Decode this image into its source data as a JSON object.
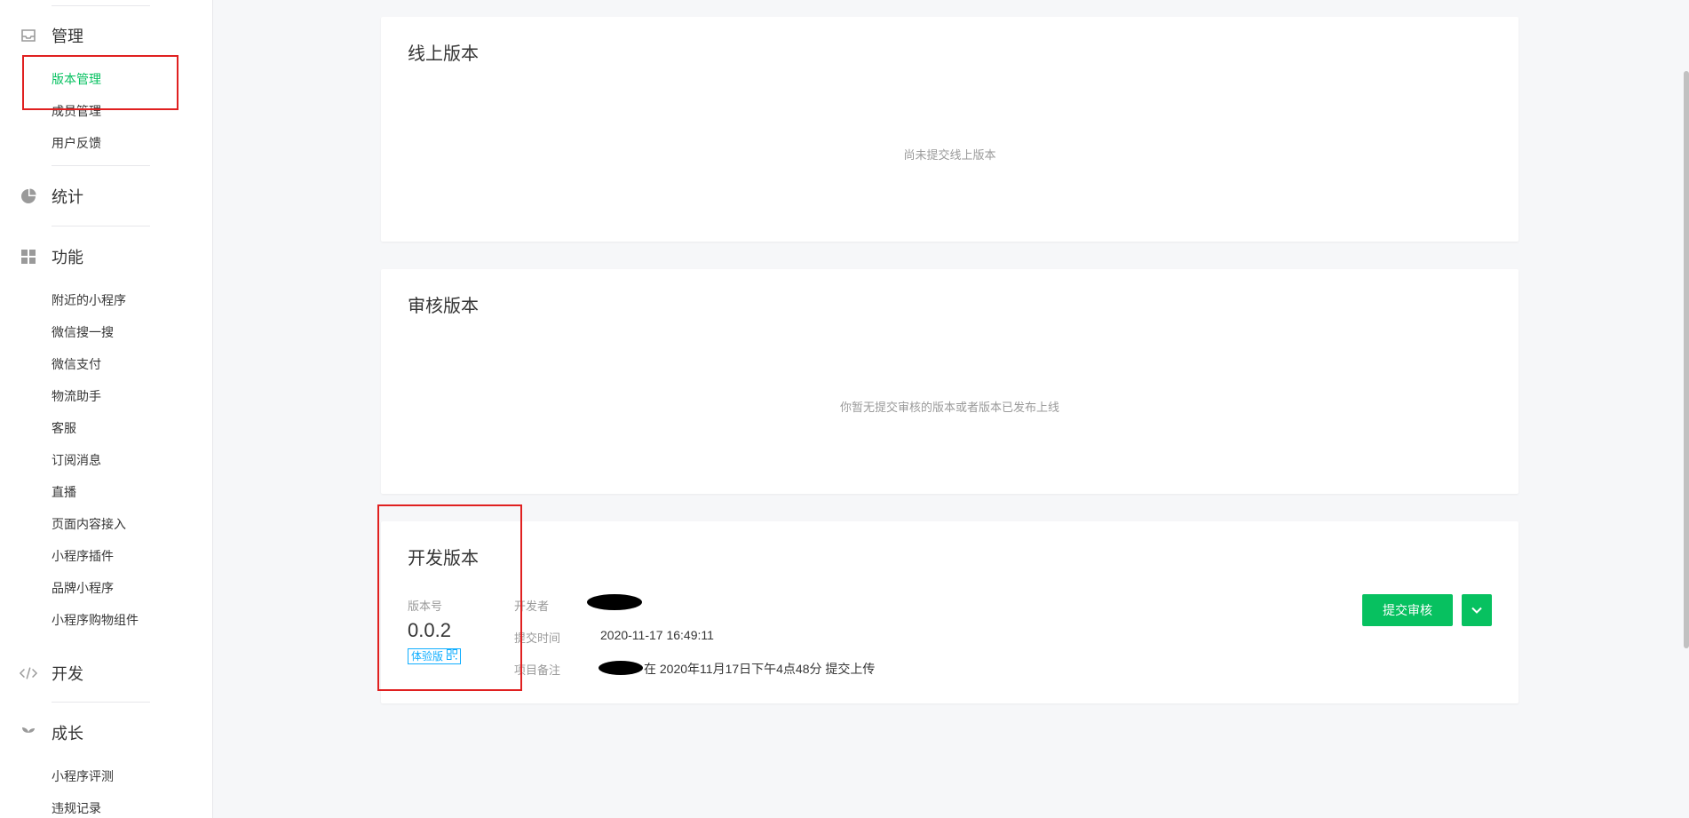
{
  "sidebar": {
    "manage": {
      "label": "管理",
      "icon": "inbox-icon",
      "items": [
        "版本管理",
        "成员管理",
        "用户反馈"
      ]
    },
    "stats": {
      "label": "统计",
      "icon": "pie-chart-icon"
    },
    "features": {
      "label": "功能",
      "icon": "grid-icon",
      "items": [
        "附近的小程序",
        "微信搜一搜",
        "微信支付",
        "物流助手",
        "客服",
        "订阅消息",
        "直播",
        "页面内容接入",
        "小程序插件",
        "品牌小程序",
        "小程序购物组件"
      ]
    },
    "develop": {
      "label": "开发",
      "icon": "code-icon"
    },
    "growth": {
      "label": "成长",
      "icon": "sprout-icon",
      "items": [
        "小程序评测",
        "违规记录"
      ]
    }
  },
  "online": {
    "title": "线上版本",
    "empty": "尚未提交线上版本"
  },
  "review": {
    "title": "审核版本",
    "empty": "你暂无提交审核的版本或者版本已发布上线"
  },
  "dev": {
    "title": "开发版本",
    "version_label": "版本号",
    "version": "0.0.2",
    "badge": "体验版",
    "developer_label": "开发者",
    "submit_time_label": "提交时间",
    "submit_time": "2020-11-17 16:49:11",
    "remark_label": "项目备注",
    "remark": "在 2020年11月17日下午4点48分 提交上传",
    "submit_button": "提交审核"
  },
  "colors": {
    "accent": "#07c160",
    "badge": "#10aeff",
    "highlight": "#e02020"
  }
}
